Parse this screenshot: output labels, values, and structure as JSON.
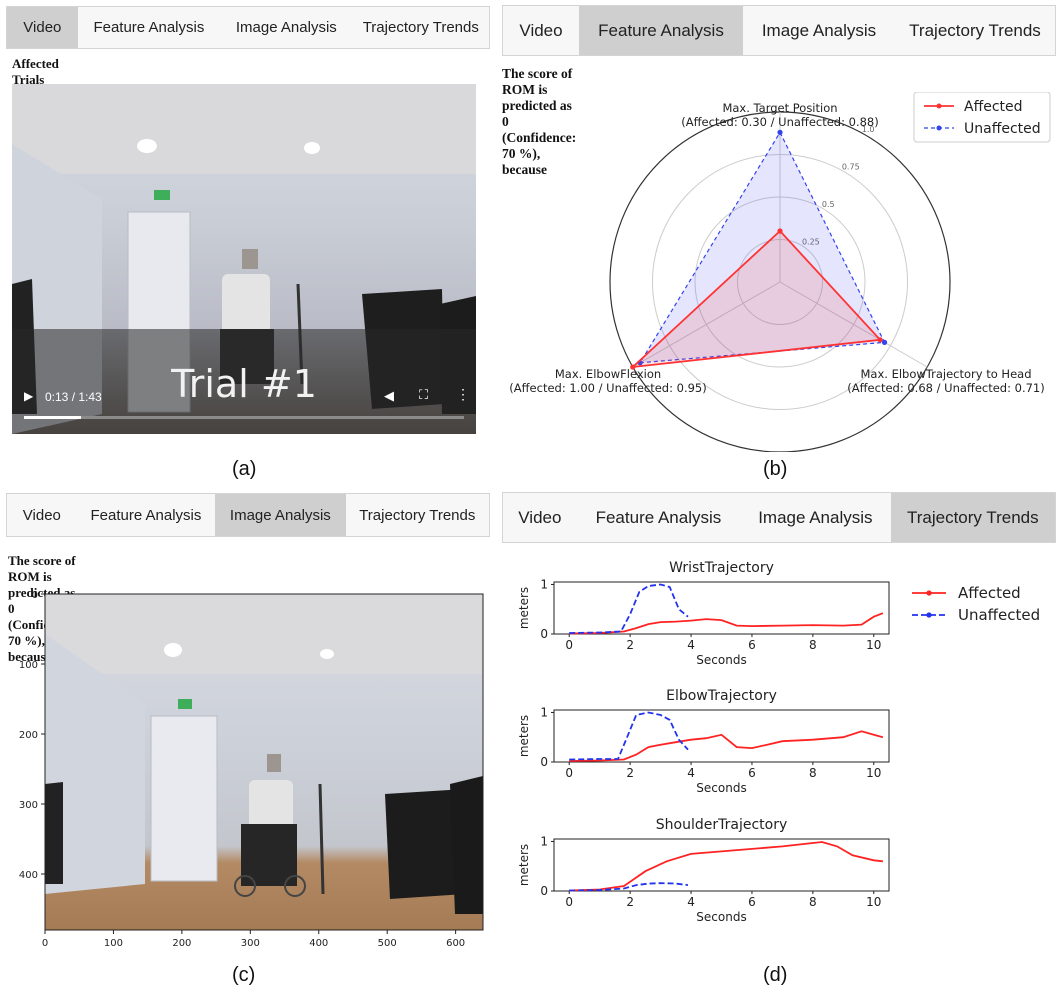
{
  "tabs": {
    "video": "Video",
    "feature": "Feature Analysis",
    "image": "Image Analysis",
    "trends": "Trajectory Trends"
  },
  "panel_a": {
    "heading": "Affected Trials",
    "overlay_text": "Trial #1",
    "time": "0:13 / 1:43",
    "progress": 0.13,
    "caption": "(a)"
  },
  "panel_b": {
    "heading": "The score of ROM is predicted as 0 (Confidence: 70 %), because",
    "caption": "(b)"
  },
  "panel_c": {
    "heading": "The score of ROM is predicted as 0 (Confidence: 70 %), because",
    "caption": "(c)"
  },
  "panel_d": {
    "caption": "(d)"
  },
  "chart_data": [
    {
      "type": "radar",
      "axes": [
        {
          "label": "Max. Target Position",
          "sub": "(Affected: 0.30 / Unaffected: 0.88)"
        },
        {
          "label": "Max. ElbowTrajectory to Head",
          "sub": "(Affected: 0.68 / Unaffected: 0.71)"
        },
        {
          "label": "Max. ElbowFlexion",
          "sub": "(Affected: 1.00 / Unaffected: 0.95)"
        }
      ],
      "series": [
        {
          "name": "Affected",
          "values": [
            0.3,
            0.68,
            1.0
          ],
          "color": "#ff3333",
          "style": "solid"
        },
        {
          "name": "Unaffected",
          "values": [
            0.88,
            0.71,
            0.95
          ],
          "color": "#3344ee",
          "style": "dashed"
        }
      ],
      "ticks": [
        "0.25",
        "0.5",
        "0.75",
        "1.0"
      ],
      "range": [
        0,
        1
      ]
    },
    {
      "type": "line",
      "panels": [
        {
          "title": "WristTrajectory",
          "xlabel": "Seconds",
          "ylabel": "meters",
          "series": [
            {
              "name": "Affected",
              "color": "#ff2222",
              "style": "solid",
              "x": [
                0,
                1,
                1.8,
                2.2,
                2.6,
                3,
                3.5,
                4,
                4.5,
                5,
                5.5,
                6,
                7,
                8,
                9,
                9.6,
                10,
                10.3
              ],
              "y": [
                0.01,
                0.02,
                0.05,
                0.12,
                0.2,
                0.24,
                0.25,
                0.27,
                0.3,
                0.28,
                0.17,
                0.16,
                0.17,
                0.18,
                0.17,
                0.19,
                0.35,
                0.42
              ]
            },
            {
              "name": "Unaffected",
              "color": "#2233ee",
              "style": "dashed",
              "x": [
                0,
                1,
                1.7,
                2,
                2.3,
                2.6,
                3,
                3.3,
                3.6,
                3.9
              ],
              "y": [
                0.02,
                0.03,
                0.05,
                0.4,
                0.85,
                0.97,
                1.0,
                0.95,
                0.5,
                0.35
              ]
            }
          ]
        },
        {
          "title": "ElbowTrajectory",
          "xlabel": "Seconds",
          "ylabel": "meters",
          "series": [
            {
              "name": "Affected",
              "color": "#ff2222",
              "style": "solid",
              "x": [
                0,
                1,
                1.8,
                2.2,
                2.6,
                3,
                3.5,
                4,
                4.5,
                5,
                5.5,
                6,
                6.5,
                7,
                8,
                9,
                9.6,
                10,
                10.3
              ],
              "y": [
                0.02,
                0.03,
                0.05,
                0.15,
                0.3,
                0.35,
                0.4,
                0.45,
                0.48,
                0.55,
                0.3,
                0.28,
                0.35,
                0.42,
                0.45,
                0.5,
                0.62,
                0.55,
                0.5
              ]
            },
            {
              "name": "Unaffected",
              "color": "#2233ee",
              "style": "dashed",
              "x": [
                0,
                1,
                1.6,
                1.9,
                2.2,
                2.6,
                3,
                3.3,
                3.6,
                3.9
              ],
              "y": [
                0.05,
                0.06,
                0.06,
                0.5,
                0.95,
                1.0,
                0.95,
                0.85,
                0.45,
                0.25
              ]
            }
          ]
        },
        {
          "title": "ShoulderTrajectory",
          "xlabel": "Seconds",
          "ylabel": "meters",
          "series": [
            {
              "name": "Affected",
              "color": "#ff2222",
              "style": "solid",
              "x": [
                0,
                1,
                1.8,
                2.5,
                3.2,
                4,
                5,
                6,
                7,
                8,
                8.3,
                8.8,
                9.3,
                10,
                10.3
              ],
              "y": [
                0.01,
                0.03,
                0.1,
                0.4,
                0.6,
                0.75,
                0.8,
                0.85,
                0.9,
                0.97,
                0.99,
                0.9,
                0.72,
                0.62,
                0.6
              ]
            },
            {
              "name": "Unaffected",
              "color": "#2233ee",
              "style": "dashed",
              "x": [
                0,
                1,
                1.8,
                2.2,
                2.6,
                3,
                3.5,
                3.9
              ],
              "y": [
                0.01,
                0.02,
                0.05,
                0.12,
                0.15,
                0.16,
                0.15,
                0.12
              ]
            }
          ]
        }
      ],
      "x_ticks": [
        0,
        2,
        4,
        6,
        8,
        10
      ],
      "y_ticks": [
        0,
        1
      ],
      "xlim": [
        -0.5,
        10.5
      ],
      "ylim": [
        0,
        1.05
      ],
      "legend": [
        "Affected",
        "Unaffected"
      ]
    },
    {
      "type": "image-axes",
      "x_ticks": [
        0,
        100,
        200,
        300,
        400,
        500,
        600
      ],
      "y_ticks": [
        0,
        100,
        200,
        300,
        400
      ],
      "xlim": [
        0,
        640
      ],
      "ylim": [
        480,
        0
      ]
    }
  ]
}
